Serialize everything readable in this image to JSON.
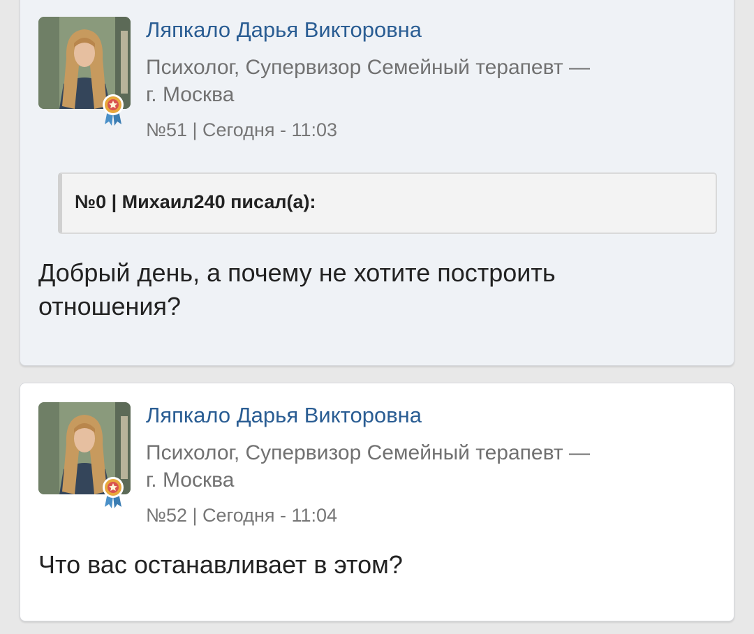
{
  "posts": [
    {
      "author": "Ляпкало Дарья Викторовна",
      "title_line1": "Психолог, Супервизор Семейный терапевт —",
      "title_line2": "г. Москва",
      "meta": "№51 | Сегодня - 11:03",
      "quote_header": "№0 | Михаил240 писал(а):",
      "text_line1": "Добрый день, а почему не хотите построить",
      "text_line2": "отношения?"
    },
    {
      "author": "Ляпкало Дарья Викторовна",
      "title_line1": "Психолог, Супервизор Семейный терапевт —",
      "title_line2": "г. Москва",
      "meta": "№52 | Сегодня - 11:04",
      "text_line1": "Что вас останавливает в этом?"
    }
  ],
  "colors": {
    "author_link": "#2a5d93",
    "secondary_text": "#717171",
    "quoted_post_bg": "#eff2f6",
    "post_bg": "#ffffff",
    "badge_ribbon": "#4a90c8",
    "badge_medal": "#e8a83c"
  },
  "icons": [
    "user-avatar",
    "award-badge-icon"
  ]
}
